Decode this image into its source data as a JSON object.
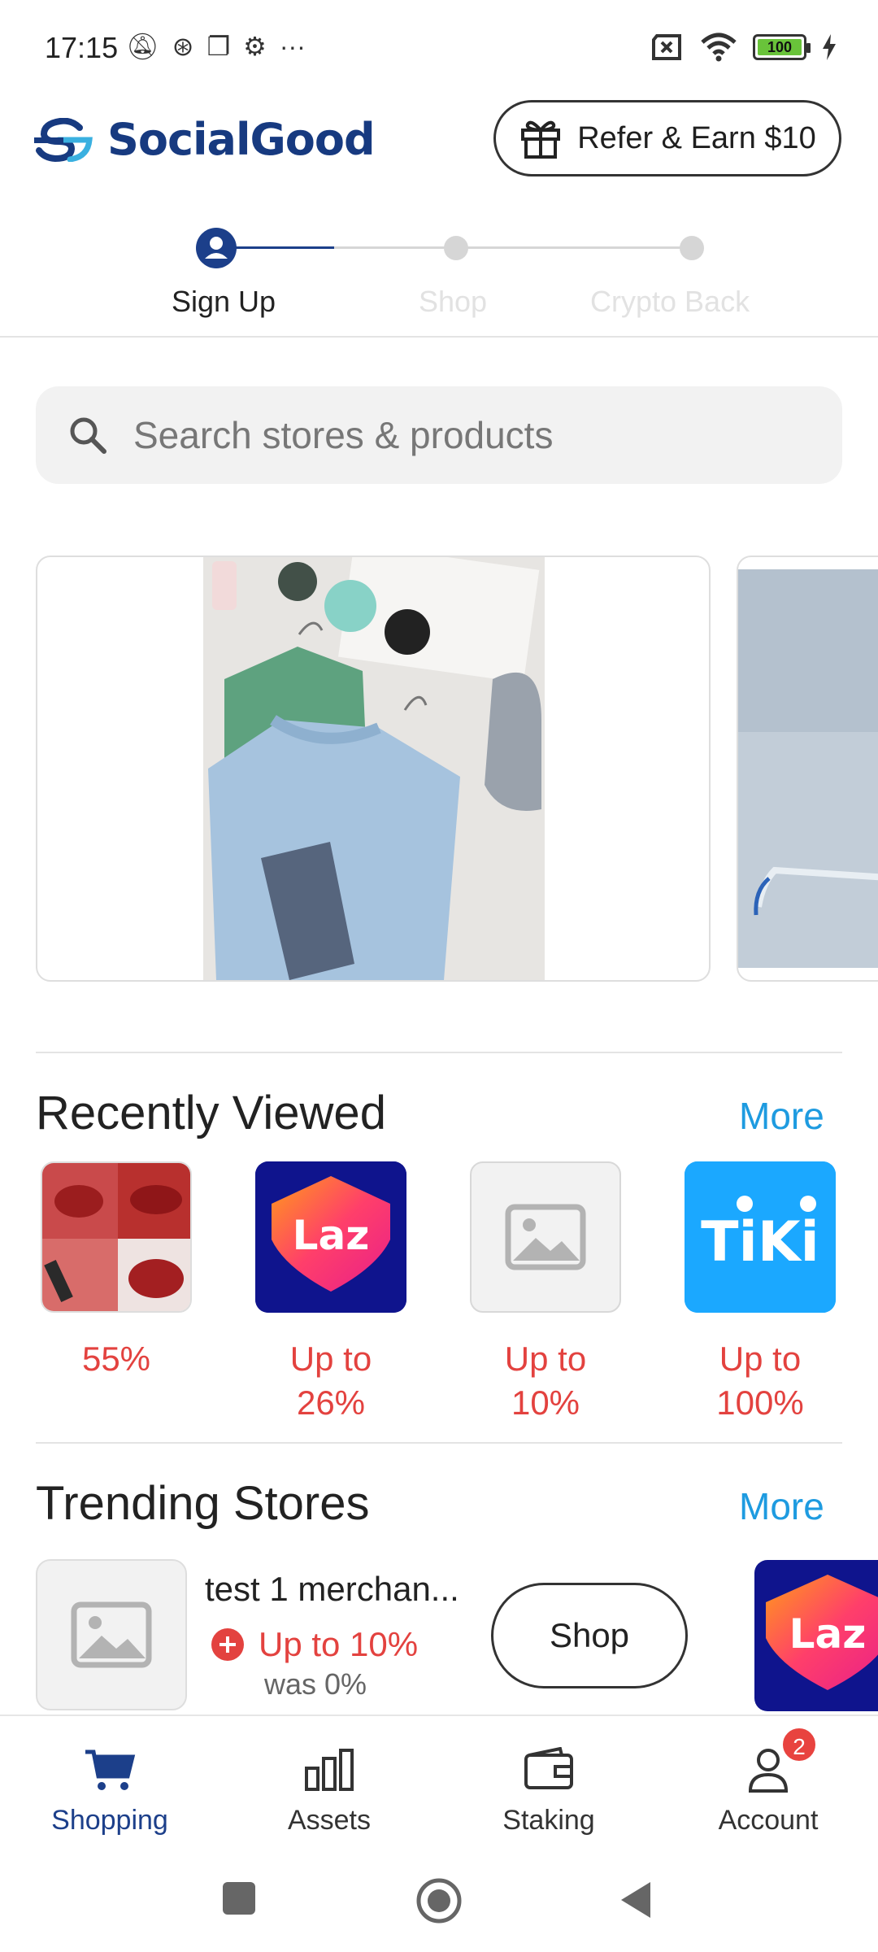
{
  "status_bar": {
    "time": "17:15",
    "battery": "100"
  },
  "header": {
    "app_name": "SocialGood",
    "refer_label": "Refer & Earn $10",
    "brand_color": "#173a80"
  },
  "stepper": {
    "steps": [
      {
        "label": "Sign Up",
        "state": "active"
      },
      {
        "label": "Shop",
        "state": "inactive"
      },
      {
        "label": "Crypto Back",
        "state": "inactive"
      }
    ]
  },
  "search": {
    "placeholder": "Search stores & products"
  },
  "recently_viewed": {
    "title": "Recently Viewed",
    "more": "More",
    "items": [
      {
        "icon": "lipstick-product-image",
        "label": "55%"
      },
      {
        "icon": "lazada-logo",
        "label": "Up to 26%"
      },
      {
        "icon": "placeholder-image-icon",
        "label": "Up to 10%"
      },
      {
        "icon": "tiki-logo",
        "label": "Up to 100%"
      }
    ]
  },
  "trending_stores": {
    "title": "Trending Stores",
    "more": "More",
    "store": {
      "name": "test 1 merchan...",
      "rate": "Up to 10%",
      "was": "was 0%",
      "shop_label": "Shop"
    },
    "peek_logo": "Laz"
  },
  "lazada_logo_text": "Laz",
  "tiki_logo_text": "TiKi",
  "bottom_nav": {
    "items": [
      {
        "label": "Shopping",
        "icon": "cart-icon",
        "active": true
      },
      {
        "label": "Assets",
        "icon": "bar-chart-icon",
        "active": false
      },
      {
        "label": "Staking",
        "icon": "wallet-icon",
        "active": false
      },
      {
        "label": "Account",
        "icon": "person-icon",
        "active": false,
        "badge": "2"
      }
    ]
  },
  "colors": {
    "accent": "#1e9be0",
    "discount": "#e3423f",
    "active_nav": "#1c3f8a"
  }
}
